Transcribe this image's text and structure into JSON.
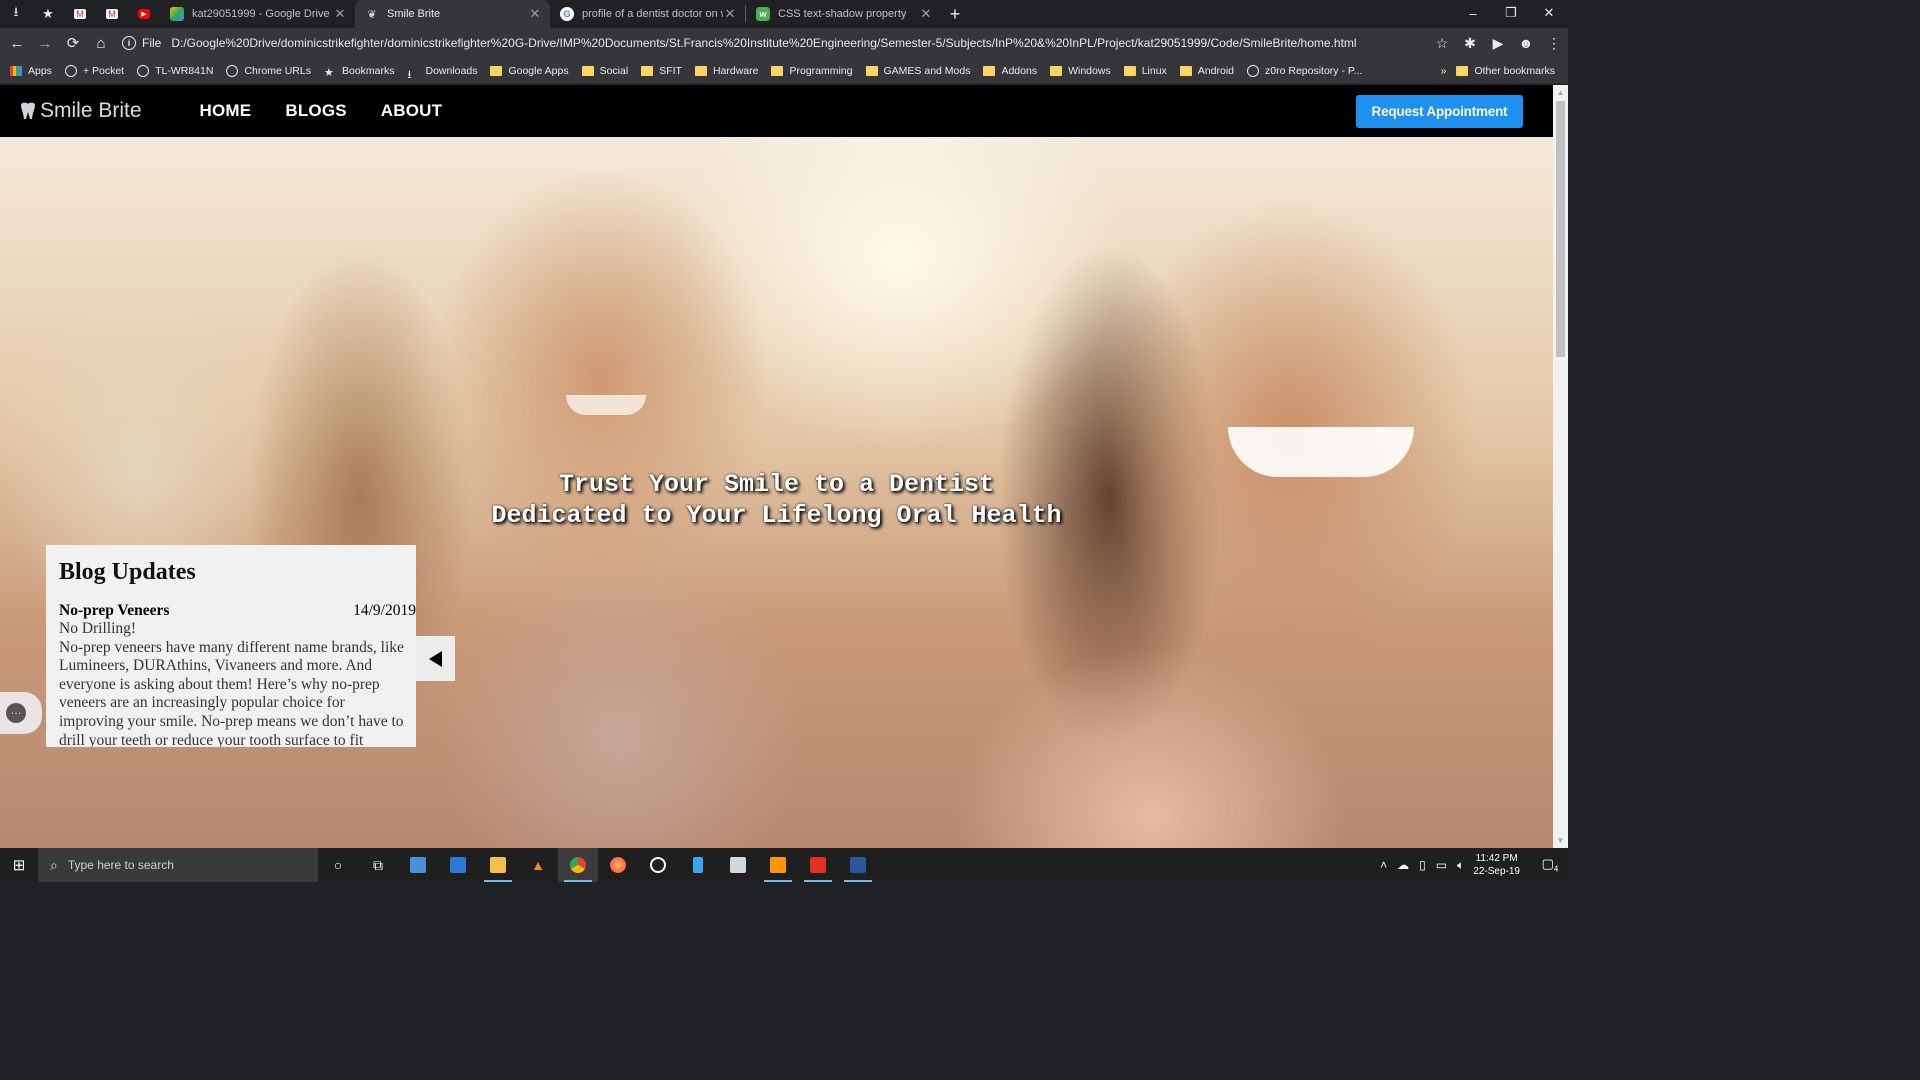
{
  "browser": {
    "pinned_tabs": [
      "download-icon",
      "star-icon",
      "gmail-icon",
      "gmail-icon",
      "youtube-icon"
    ],
    "tabs": [
      {
        "title": "kat29051999 - Google Drive",
        "favicon_color": "#34a853",
        "active": false
      },
      {
        "title": "Smile Brite",
        "favicon_color": "#9aa0a6",
        "active": true
      },
      {
        "title": "profile of a dentist doctor on wel",
        "favicon_color": "#4285f4",
        "active": false
      },
      {
        "title": "CSS text-shadow property",
        "favicon_color": "#4caf50",
        "active": false
      }
    ],
    "new_tab": "+",
    "window_controls": [
      "–",
      "❐",
      "✕"
    ],
    "address": {
      "scheme": "File",
      "url": "D:/Google%20Drive/dominicstrikefighter/dominicstrikefighter%20G-Drive/IMP%20Documents/St.Francis%20Institute%20Engineering/Semester-5/Subjects/InP%20&%20InPL/Project/kat29051999/Code/SmileBrite/home.html"
    },
    "bookmarks": [
      {
        "label": "Apps",
        "icon": "apps-icon"
      },
      {
        "label": "+ Pocket",
        "icon": "globe-icon"
      },
      {
        "label": "TL-WR841N",
        "icon": "globe-icon"
      },
      {
        "label": "Chrome URLs",
        "icon": "globe-icon"
      },
      {
        "label": "Bookmarks",
        "icon": "star-icon"
      },
      {
        "label": "Downloads",
        "icon": "download-icon"
      },
      {
        "label": "Google Apps",
        "icon": "folder-icon"
      },
      {
        "label": "Social",
        "icon": "folder-icon"
      },
      {
        "label": "SFIT",
        "icon": "folder-icon"
      },
      {
        "label": "Hardware",
        "icon": "folder-icon"
      },
      {
        "label": "Programming",
        "icon": "folder-icon"
      },
      {
        "label": "GAMES and Mods",
        "icon": "folder-icon"
      },
      {
        "label": "Addons",
        "icon": "folder-icon"
      },
      {
        "label": "Windows",
        "icon": "folder-icon"
      },
      {
        "label": "Linux",
        "icon": "folder-icon"
      },
      {
        "label": "Android",
        "icon": "folder-icon"
      },
      {
        "label": "z0ro Repository - P...",
        "icon": "globe-icon"
      }
    ],
    "bookmarks_more": "»",
    "other_bookmarks": "Other bookmarks"
  },
  "site": {
    "logo": "Smile Brite",
    "nav": [
      "HOME",
      "BLOGS",
      "ABOUT"
    ],
    "cta": "Request Appointment",
    "headline_line1": "Trust Your Smile to a Dentist",
    "headline_line2": "Dedicated to Your Lifelong Oral Health",
    "blog": {
      "heading": "Blog Updates",
      "post_title": "No-prep Veneers",
      "post_date": "14/9/2019",
      "post_subtitle": "No Drilling!",
      "post_body": "No-prep veneers have many different name brands, like Lumineers, DURAthins, Vivaneers and more. And everyone is asking about them! Here’s why no-prep veneers are an increasingly popular choice for improving your smile. No-prep means we don’t have to drill your teeth or reduce your tooth surface to fit"
    },
    "chat_icon": "…"
  },
  "taskbar": {
    "search_placeholder": "Type here to search",
    "time": "11:42 PM",
    "date": "22-Sep-19",
    "notification_count": "4",
    "accent": "#76b9ed"
  }
}
